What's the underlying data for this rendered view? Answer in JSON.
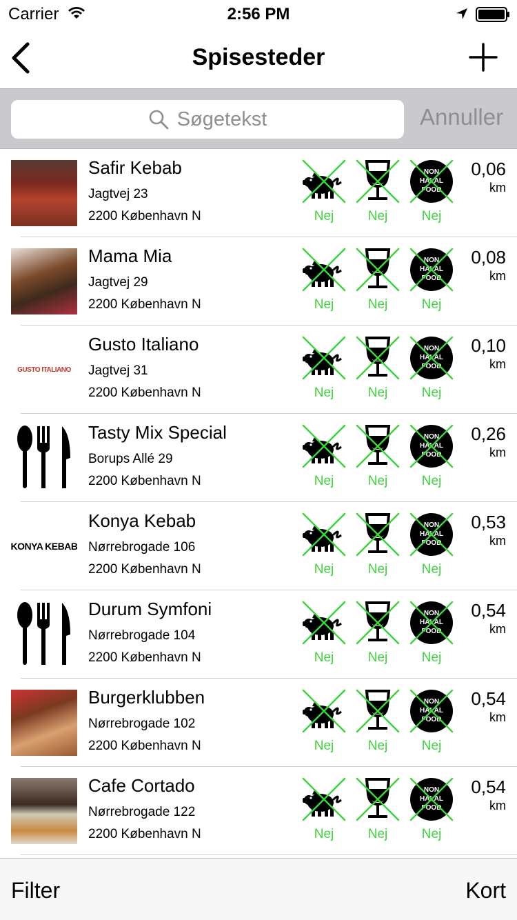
{
  "status_bar": {
    "carrier": "Carrier",
    "time": "2:56 PM"
  },
  "nav": {
    "title": "Spisesteder"
  },
  "search": {
    "placeholder": "Søgetekst",
    "cancel_label": "Annuller"
  },
  "feature_label": "Nej",
  "distance_unit": "km",
  "restaurants": [
    {
      "name": "Safir Kebab",
      "street": "Jagtvej  23",
      "city": "2200 København N",
      "distance": "0,06",
      "image": "photo"
    },
    {
      "name": "Mama Mia",
      "street": "Jagtvej  29",
      "city": "2200 København N",
      "distance": "0,08",
      "image": "photo"
    },
    {
      "name": "Gusto Italiano",
      "street": "Jagtvej 31",
      "city": "2200 København N",
      "distance": "0,10",
      "image": "logo",
      "logo_text": "GUSTO ITALIANO"
    },
    {
      "name": "Tasty Mix Special",
      "street": "Borups Allé 29",
      "city": "2200 København N",
      "distance": "0,26",
      "image": "cutlery"
    },
    {
      "name": "Konya Kebab",
      "street": "Nørrebrogade 106",
      "city": "2200 København N",
      "distance": "0,53",
      "image": "logo",
      "logo_text": "KONYA KEBAB"
    },
    {
      "name": "Durum Symfoni",
      "street": "Nørrebrogade 104",
      "city": "2200 København N",
      "distance": "0,54",
      "image": "cutlery"
    },
    {
      "name": "Burgerklubben",
      "street": "Nørrebrogade 102",
      "city": "2200 København N",
      "distance": "0,54",
      "image": "photo"
    },
    {
      "name": "Cafe Cortado",
      "street": "Nørrebrogade 122",
      "city": "2200 København N",
      "distance": "0,54",
      "image": "photo"
    }
  ],
  "badge_text": [
    "NON",
    "HALAL",
    "FOOD"
  ],
  "toolbar": {
    "filter_label": "Filter",
    "map_label": "Kort"
  },
  "colors": {
    "accent_green": "#3ed43e",
    "search_bar_bg": "#c9c9ce",
    "placeholder_gray": "#8e8e93"
  },
  "icons": [
    "wifi-icon",
    "location-icon",
    "battery-icon",
    "back-chevron-icon",
    "plus-icon",
    "search-icon",
    "pig-icon",
    "wine-glass-icon",
    "non-halal-food-icon",
    "cutlery-icon"
  ]
}
